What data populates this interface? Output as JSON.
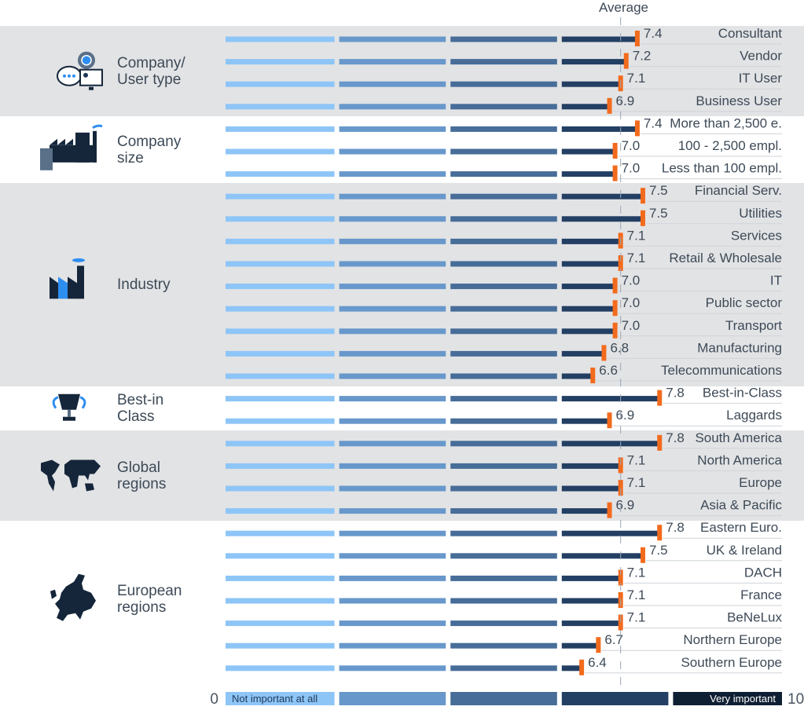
{
  "chart_data": {
    "type": "bar",
    "orientation": "horizontal",
    "title": "",
    "xlabel": "",
    "ylabel": "",
    "xlim": [
      0,
      10
    ],
    "average": {
      "label": "Average",
      "value": 7.1
    },
    "scale": {
      "min_label": "0",
      "max_label": "10",
      "low_text": "Not important at all",
      "high_text": "Very important",
      "segments": [
        0,
        2,
        4,
        6,
        8,
        10
      ]
    },
    "groups": [
      {
        "name": "Company/\nUser type",
        "icon": "settings-chat-monitor-icon",
        "shaded": true,
        "items": [
          {
            "label": "Consultant",
            "value": 7.4
          },
          {
            "label": "Vendor",
            "value": 7.2
          },
          {
            "label": "IT User",
            "value": 7.1
          },
          {
            "label": "Business User",
            "value": 6.9
          }
        ]
      },
      {
        "name": "Company\nsize",
        "icon": "factory-buildings-icon",
        "shaded": false,
        "items": [
          {
            "label": "More than 2,500 e.",
            "value": 7.4
          },
          {
            "label": "100 - 2,500 empl.",
            "value": 7.0
          },
          {
            "label": "Less than 100 empl.",
            "value": 7.0
          }
        ]
      },
      {
        "name": "Industry",
        "icon": "factory-icon",
        "shaded": true,
        "items": [
          {
            "label": "Financial Serv.",
            "value": 7.5
          },
          {
            "label": "Utilities",
            "value": 7.5
          },
          {
            "label": "Services",
            "value": 7.1
          },
          {
            "label": "Retail & Wholesale",
            "value": 7.1
          },
          {
            "label": "IT",
            "value": 7.0
          },
          {
            "label": "Public sector",
            "value": 7.0
          },
          {
            "label": "Transport",
            "value": 7.0
          },
          {
            "label": "Manufacturing",
            "value": 6.8
          },
          {
            "label": "Telecommunications",
            "value": 6.6
          }
        ]
      },
      {
        "name": "Best-in\nClass",
        "icon": "trophy-icon",
        "shaded": false,
        "items": [
          {
            "label": "Best-in-Class",
            "value": 7.8
          },
          {
            "label": "Laggards",
            "value": 6.9
          }
        ]
      },
      {
        "name": "Global\nregions",
        "icon": "world-map-icon",
        "shaded": true,
        "items": [
          {
            "label": "South America",
            "value": 7.8
          },
          {
            "label": "North America",
            "value": 7.1
          },
          {
            "label": "Europe",
            "value": 7.1
          },
          {
            "label": "Asia & Pacific",
            "value": 6.9
          }
        ]
      },
      {
        "name": "European\nregions",
        "icon": "europe-map-icon",
        "shaded": false,
        "items": [
          {
            "label": "Eastern Euro.",
            "value": 7.8
          },
          {
            "label": "UK & Ireland",
            "value": 7.5
          },
          {
            "label": "DACH",
            "value": 7.1
          },
          {
            "label": "France",
            "value": 7.1
          },
          {
            "label": "BeNeLux",
            "value": 7.1
          },
          {
            "label": "Northern Europe",
            "value": 6.7
          },
          {
            "label": "Southern Europe",
            "value": 6.4
          }
        ]
      }
    ],
    "colors": {
      "segment_1": "#8ec5f7",
      "segment_2": "#6898cb",
      "segment_3": "#476d98",
      "segment_4": "#233f63",
      "segment_5": "#0f1f33",
      "marker": "#f26b1d",
      "band": "#e2e3e5",
      "text": "#3d4a57"
    }
  }
}
